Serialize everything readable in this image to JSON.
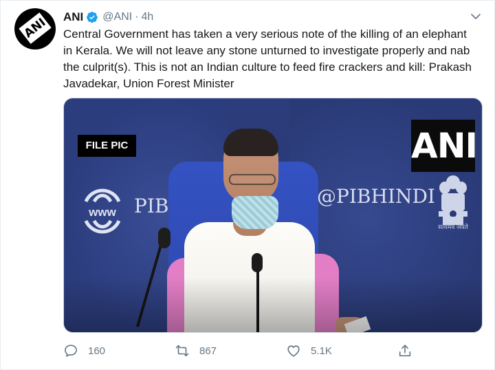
{
  "tweet": {
    "author_name": "ANI",
    "handle": "@ANI",
    "separator": "·",
    "time": "4h",
    "verified": true,
    "avatar_logo_text": "ANI",
    "text": "Central Government has taken a very serious note of the killing of an elephant in Kerala. We will not leave any stone unturned to investigate properly and nab the culprit(s). This is not an Indian culture to feed fire crackers and kill: Prakash Javadekar, Union Forest Minister"
  },
  "media": {
    "file_pic_label": "FILE PIC",
    "watermark": "ANI",
    "backdrop_left_text": "PIB.(",
    "backdrop_right_text": "@PIBHINDI",
    "globe_label": "www",
    "emblem_caption": "सत्यमेव जयते"
  },
  "actions": {
    "reply_count": "160",
    "retweet_count": "867",
    "like_count": "5.1K"
  },
  "icons": {
    "reply": "reply-icon",
    "retweet": "retweet-icon",
    "like": "heart-icon",
    "share": "share-icon",
    "more": "chevron-down-icon",
    "verified": "verified-badge-icon"
  },
  "colors": {
    "text": "#14171a",
    "secondary": "#657786",
    "verified": "#1da1f2"
  }
}
